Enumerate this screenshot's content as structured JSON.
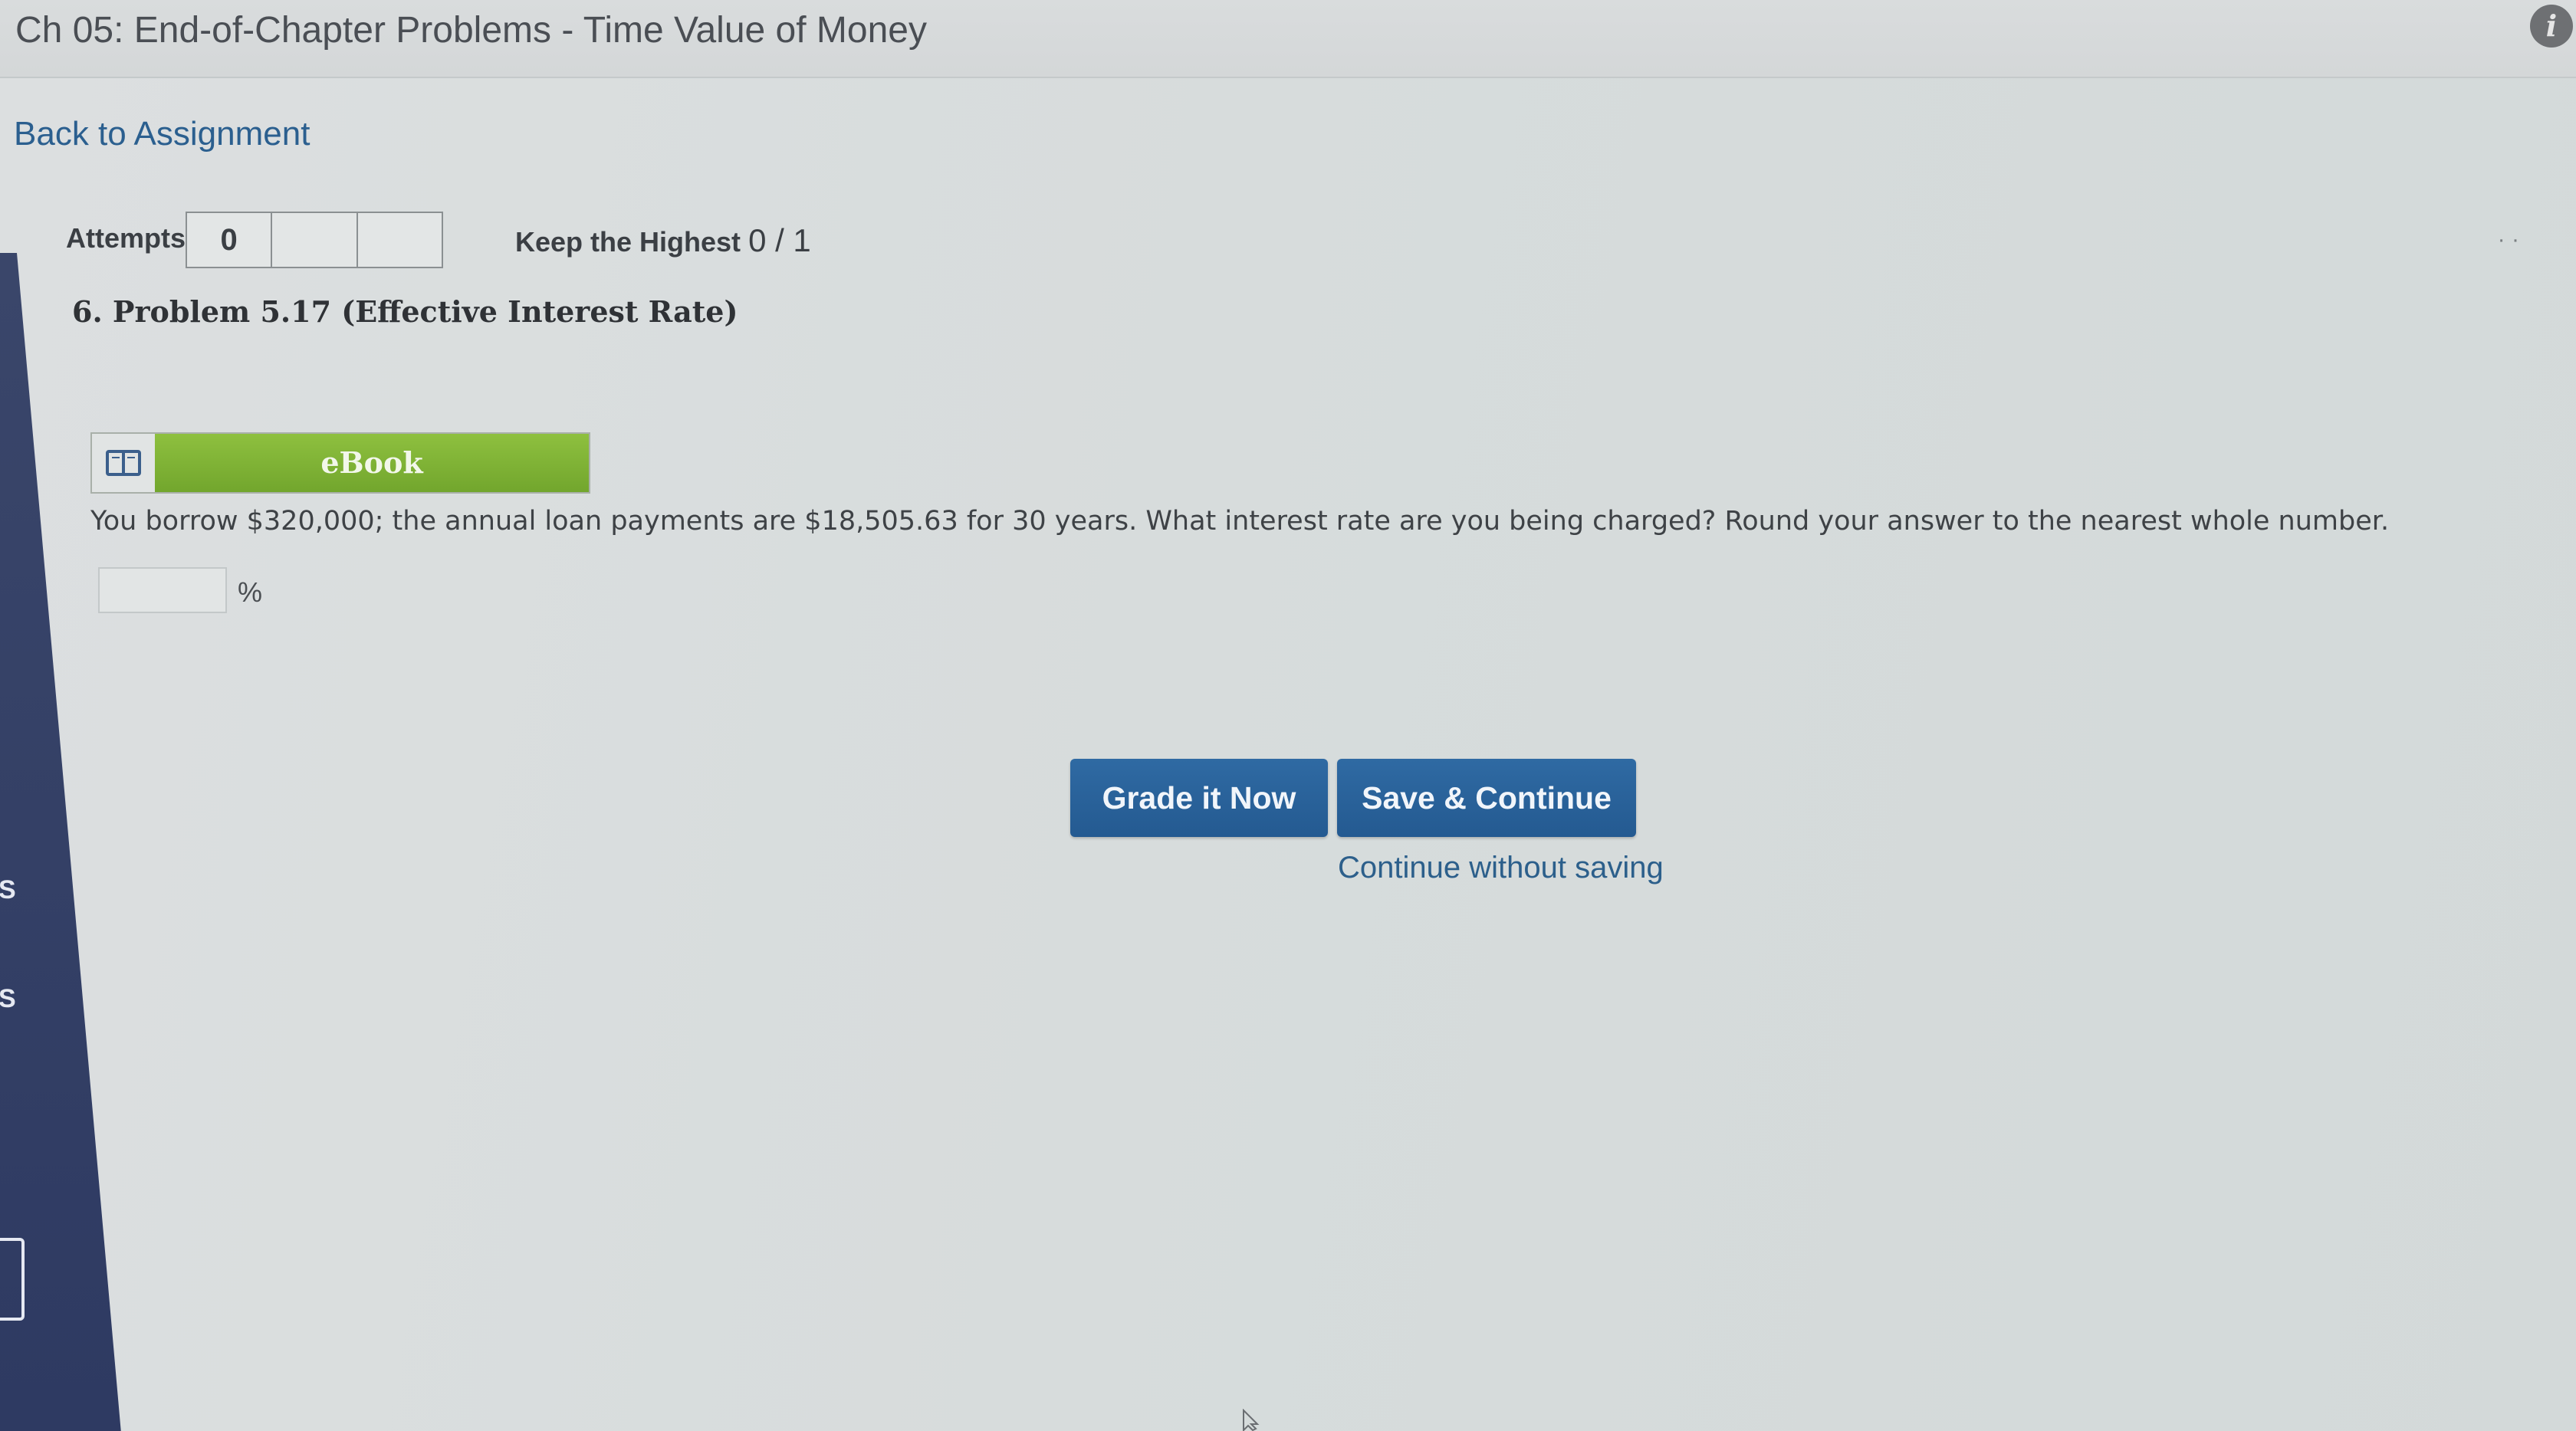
{
  "header": {
    "title": "Ch 05: End-of-Chapter Problems - Time Value of Money",
    "info_icon": "info-icon"
  },
  "nav": {
    "back_link": "Back to Assignment"
  },
  "sidebar": {
    "fragments": [
      "S",
      "S"
    ]
  },
  "attempts": {
    "label": "Attempts",
    "count": "0",
    "keep_highest_label": "Keep the Highest",
    "score": "0 / 1"
  },
  "problem": {
    "title": "6.  Problem 5.17 (Effective Interest Rate)",
    "ebook_label": "eBook",
    "ebook_icon": "book-icon",
    "question": "You borrow $320,000; the annual loan payments are $18,505.63 for 30 years. What interest rate are you being charged? Round your answer to the nearest whole number.",
    "answer_value": "",
    "answer_unit": "%"
  },
  "actions": {
    "grade_label": "Grade it Now",
    "save_label": "Save & Continue",
    "continue_label": "Continue without saving"
  },
  "colors": {
    "primary_button": "#2a62a0",
    "ebook_green": "#7fb336",
    "link": "#2b5f8f",
    "sidebar": "#313d64"
  }
}
